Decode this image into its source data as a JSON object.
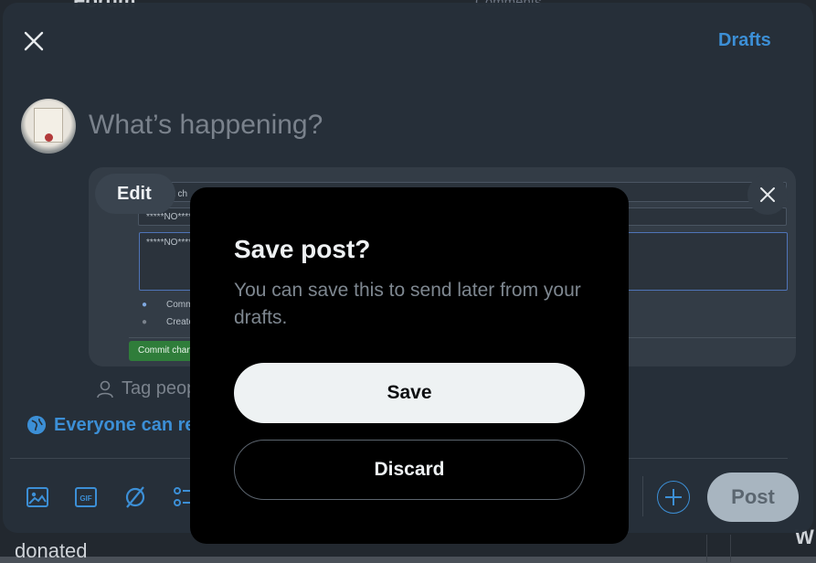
{
  "background": {
    "top_text_left": "Forum",
    "top_text_right": "Comments",
    "bottom_text_left": "donated",
    "bottom_text_right": "W"
  },
  "composer": {
    "drafts_label": "Drafts",
    "prompt_placeholder": "What’s happening?",
    "media": {
      "edit_label": "Edit",
      "field_1": "*****NO****",
      "field_2": "*****NO****",
      "field_top": "t ch",
      "radio_1": "Comm",
      "radio_2": "Create",
      "commit_label": "Commit chan"
    },
    "tag_label": "Tag peop",
    "audience_label": "Everyone can re",
    "post_label": "Post",
    "toolbar_icons": [
      "image-icon",
      "gif-icon",
      "grok-icon",
      "poll-icon"
    ]
  },
  "dialog": {
    "title": "Save post?",
    "body": "You can save this to send later from your drafts.",
    "save_label": "Save",
    "discard_label": "Discard"
  },
  "colors": {
    "accent": "#3c8fd6",
    "composer_bg": "#273039",
    "dialog_bg": "#000000"
  }
}
